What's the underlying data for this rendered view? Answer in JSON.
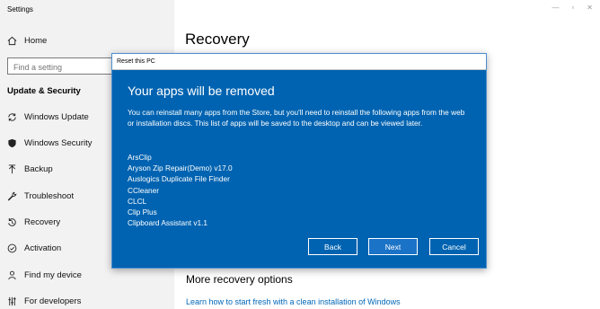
{
  "window": {
    "title": "Settings",
    "controls": [
      "—",
      "▫",
      "✕"
    ]
  },
  "sidebar": {
    "home_label": "Home",
    "search_placeholder": "Find a setting",
    "section_heading": "Update & Security",
    "items": [
      {
        "label": "Windows Update",
        "icon": "sync-icon"
      },
      {
        "label": "Windows Security",
        "icon": "shield-icon"
      },
      {
        "label": "Backup",
        "icon": "backup-arrow-icon"
      },
      {
        "label": "Troubleshoot",
        "icon": "wrench-icon"
      },
      {
        "label": "Recovery",
        "icon": "recovery-icon"
      },
      {
        "label": "Activation",
        "icon": "check-circle-icon"
      },
      {
        "label": "Find my device",
        "icon": "person-location-icon"
      },
      {
        "label": "For developers",
        "icon": "developer-tools-icon"
      }
    ]
  },
  "main": {
    "page_title": "Recovery",
    "more_heading": "More recovery options",
    "learn_link": "Learn how to start fresh with a clean installation of Windows"
  },
  "dialog": {
    "window_title": "Reset this PC",
    "heading": "Your apps will be removed",
    "message": "You can reinstall many apps from the Store, but you'll need to reinstall the following apps from the web or installation discs. This list of apps will be saved to the desktop and can be viewed later.",
    "apps": [
      "ArsClip",
      "Aryson Zip Repair(Demo) v17.0",
      "Auslogics Duplicate File Finder",
      "CCleaner",
      "CLCL",
      "Clip Plus",
      "Clipboard Assistant v1.1"
    ],
    "buttons": {
      "back": "Back",
      "next": "Next",
      "cancel": "Cancel"
    }
  },
  "colors": {
    "dialog_background": "#0063b1",
    "link": "#0067b8",
    "sidebar_background": "#f2f2f2"
  }
}
